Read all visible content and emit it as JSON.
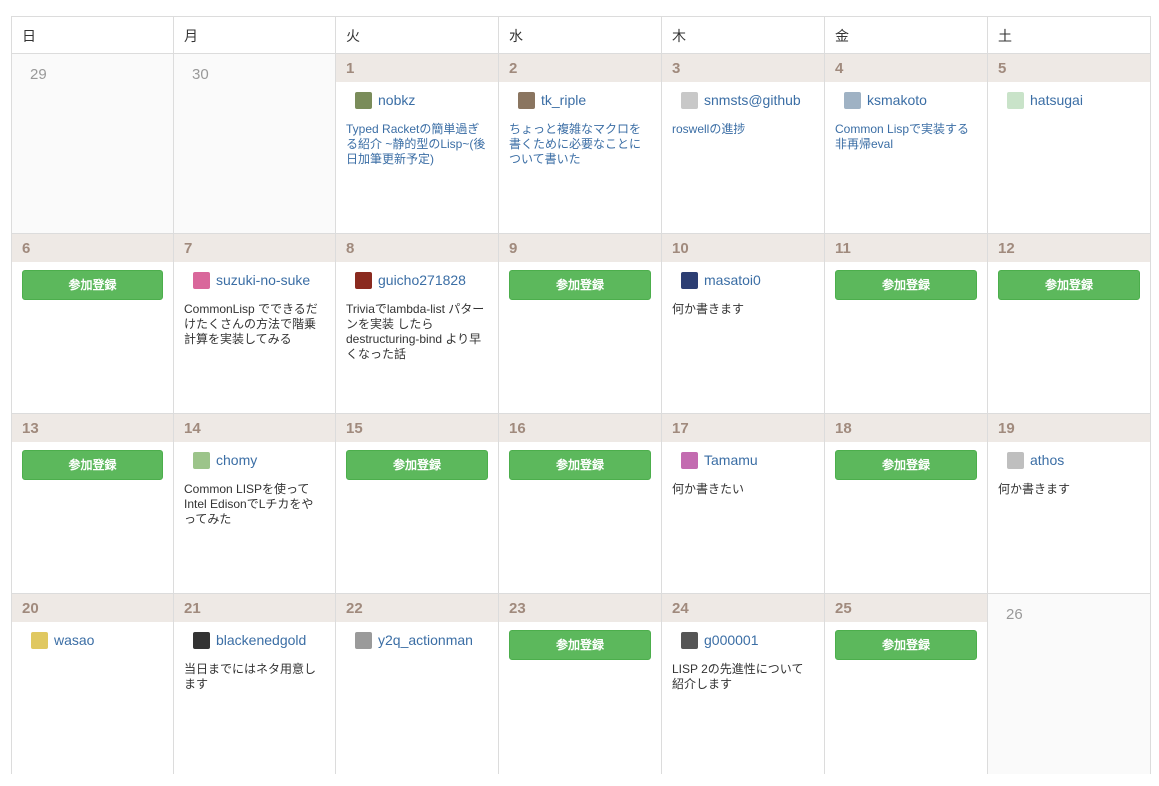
{
  "weekdays": [
    "日",
    "月",
    "火",
    "水",
    "木",
    "金",
    "土"
  ],
  "join_label": "参加登録",
  "weeks": [
    [
      {
        "day": "29",
        "out": true
      },
      {
        "day": "30",
        "out": true
      },
      {
        "day": "1",
        "user": "nobkz",
        "avatar": "#7a8c5a",
        "title": "Typed Racketの簡単過ぎる紹介 ~静的型のLisp~(後日加筆更新予定)"
      },
      {
        "day": "2",
        "user": "tk_riple",
        "avatar": "#8a7560",
        "title": "ちょっと複雑なマクロを書くために必要なことについて書いた"
      },
      {
        "day": "3",
        "user": "snmsts@github",
        "avatar": "#c8c8c8",
        "title": "roswellの進捗"
      },
      {
        "day": "4",
        "user": "ksmakoto",
        "avatar": "#9fb2c4",
        "title": "Common Lispで実装する非再帰eval"
      },
      {
        "day": "5",
        "user": "hatsugai",
        "avatar": "#c9e3c9"
      }
    ],
    [
      {
        "day": "6",
        "join": true
      },
      {
        "day": "7",
        "user": "suzuki-no-suke",
        "avatar": "#d9679b",
        "note": "CommonLisp でできるだけたくさんの方法で階乗計算を実装してみる"
      },
      {
        "day": "8",
        "user": "guicho271828",
        "avatar": "#8a2a1f",
        "note": "Triviaでlambda-list パターンを実装 したら destructuring-bind より早くなった話"
      },
      {
        "day": "9",
        "join": true
      },
      {
        "day": "10",
        "user": "masatoi0",
        "avatar": "#2c3e73",
        "note": "何か書きます"
      },
      {
        "day": "11",
        "join": true
      },
      {
        "day": "12",
        "join": true
      }
    ],
    [
      {
        "day": "13",
        "join": true
      },
      {
        "day": "14",
        "user": "chomy",
        "avatar": "#9cc48a",
        "note": "Common LISPを使ってIntel EdisonでLチカをやってみた"
      },
      {
        "day": "15",
        "join": true
      },
      {
        "day": "16",
        "join": true
      },
      {
        "day": "17",
        "user": "Tamamu",
        "avatar": "#c36bb0",
        "note": "何か書きたい"
      },
      {
        "day": "18",
        "join": true
      },
      {
        "day": "19",
        "user": "athos",
        "avatar": "#bfbfbf",
        "note": "何か書きます"
      }
    ],
    [
      {
        "day": "20",
        "user": "wasao",
        "avatar": "#e0c860"
      },
      {
        "day": "21",
        "user": "blackenedgold",
        "avatar": "#333333",
        "note": "当日までにはネタ用意します"
      },
      {
        "day": "22",
        "user": "y2q_actionman",
        "avatar": "#9a9a9a"
      },
      {
        "day": "23",
        "join": true
      },
      {
        "day": "24",
        "user": "g000001",
        "avatar": "#555555",
        "note": "LISP 2の先進性について紹介します"
      },
      {
        "day": "25",
        "join": true
      },
      {
        "day": "26",
        "out": true
      }
    ]
  ]
}
